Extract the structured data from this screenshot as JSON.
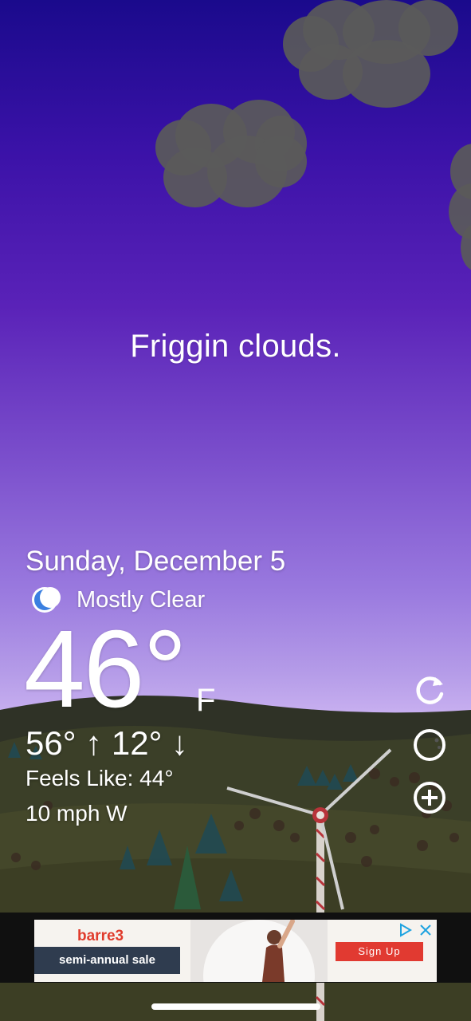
{
  "headline": "Friggin clouds.",
  "weather": {
    "date": "Sunday, December 5",
    "condition": "Mostly Clear",
    "condition_icon": "crescent-moon-icon",
    "temperature": "46°",
    "unit": "F",
    "high_low": "56° ↑ 12° ↓",
    "feels_like": "Feels Like: 44°",
    "wind": "10 mph W"
  },
  "side_buttons": [
    {
      "icon": "refresh-icon"
    },
    {
      "icon": "moon-phase-icon"
    },
    {
      "icon": "add-circle-icon"
    }
  ],
  "ad": {
    "brand": "barre3",
    "headline": "semi-annual sale",
    "cta": "Sign Up",
    "choices_icon": "ad-choices-icon",
    "close_icon": "close-icon"
  },
  "colors": {
    "sky_top": "#1a0a8c",
    "sky_bottom": "#cbb6ef",
    "cloud": "#5a5a5a",
    "moon_blue": "#3a7fe0",
    "ad_accent": "#e13a31",
    "ad_dark": "#2f3c4f"
  }
}
